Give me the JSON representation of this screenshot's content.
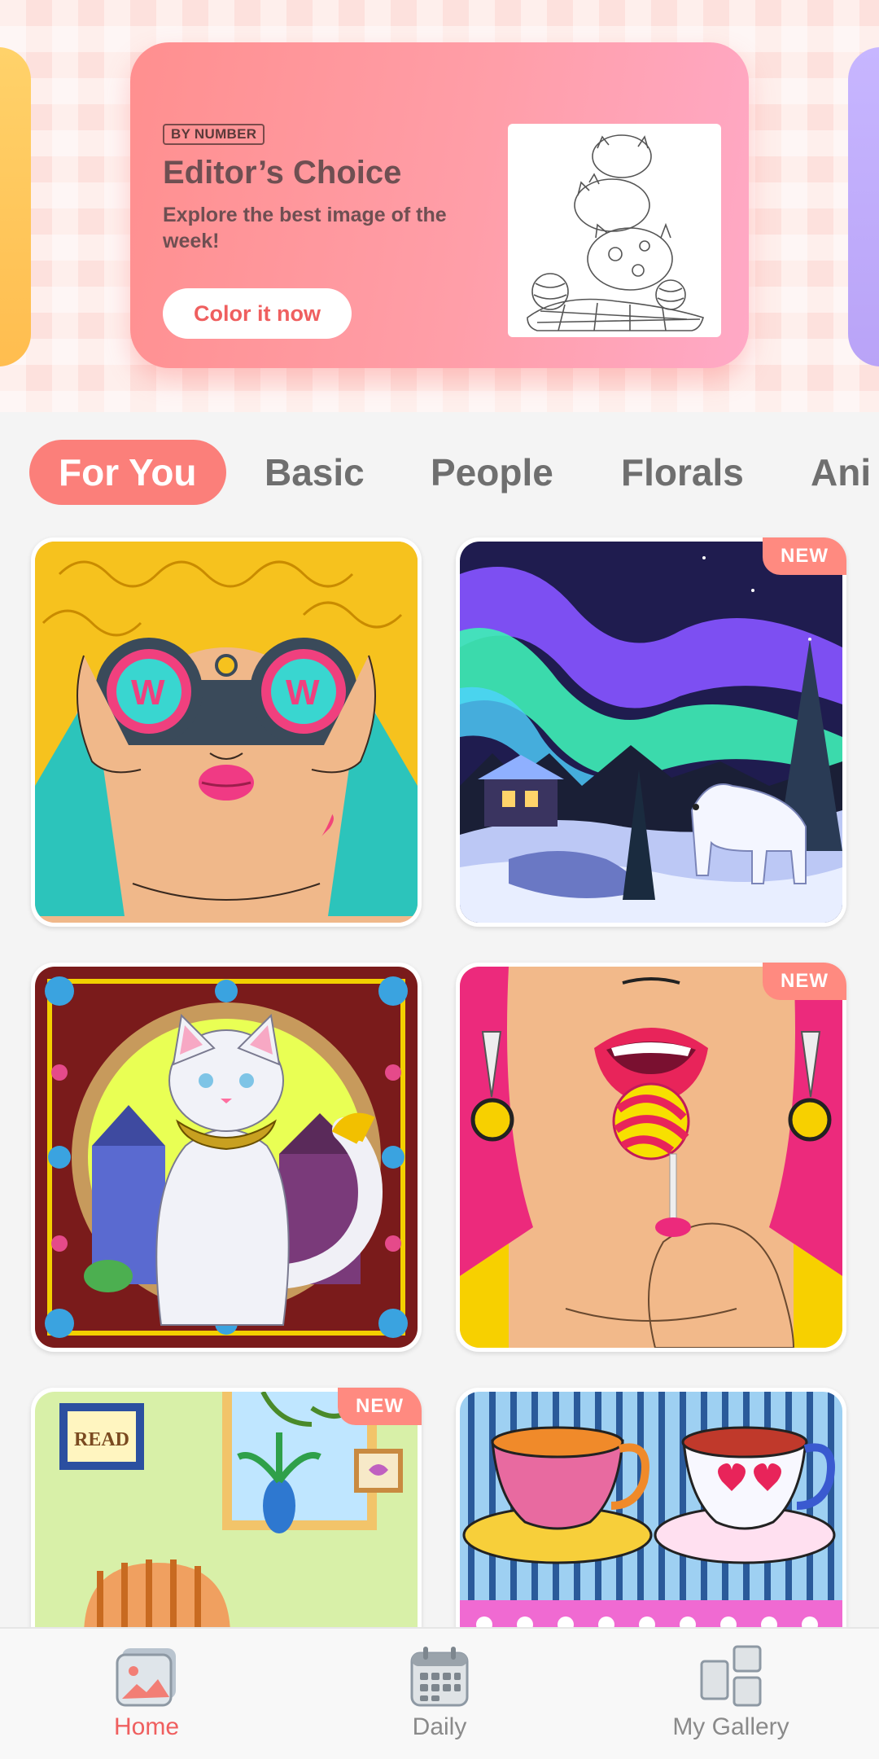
{
  "banner": {
    "tag": "BY NUMBER",
    "title": "Editor’s Choice",
    "subtitle": "Explore the best image of the week!",
    "button_label": "Color it now"
  },
  "tabs": [
    {
      "label": "For You",
      "active": true
    },
    {
      "label": "Basic",
      "active": false
    },
    {
      "label": "People",
      "active": false
    },
    {
      "label": "Florals",
      "active": false
    },
    {
      "label": "Ani",
      "active": false
    }
  ],
  "cards": [
    {
      "subject": "woman with binoculars",
      "badge": ""
    },
    {
      "subject": "northern lights polar bear",
      "badge": "NEW"
    },
    {
      "subject": "cat in ornate frame",
      "badge": ""
    },
    {
      "subject": "lips with lollipop",
      "badge": "NEW"
    },
    {
      "subject": "reading room interior",
      "badge": "NEW"
    },
    {
      "subject": "teacups",
      "badge": ""
    }
  ],
  "nav": {
    "home": {
      "label": "Home",
      "icon": "image-icon",
      "active": true
    },
    "daily": {
      "label": "Daily",
      "icon": "calendar-icon",
      "active": false
    },
    "gallery": {
      "label": "My Gallery",
      "icon": "gallery-icon",
      "active": false
    }
  },
  "colors": {
    "accent": "#fb7f7a",
    "badge": "#ff8a80",
    "active_nav": "#ef5f5f"
  }
}
